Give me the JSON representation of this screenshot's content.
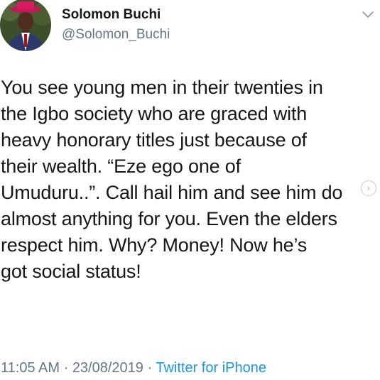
{
  "author": {
    "display_name": "Solomon Buchi",
    "handle": "@Solomon_Buchi"
  },
  "tweet": {
    "lines": [
      "You see young men in their twenties in",
      "the Igbo society who are graced with",
      "heavy honorary titles just because of",
      "their wealth. “Eze ego one of",
      "Umuduru..”. Call hail him and see him do",
      "almost anything for you. Even the elders",
      "respect him. Why? Money! Now he’s",
      "got social status!"
    ],
    "time": "11:05 AM",
    "separator1": " · ",
    "date": "23/08/2019",
    "separator2": " · ",
    "source": "Twitter for iPhone"
  },
  "icons": {
    "menu": "chevron-down-icon",
    "overlay": "chevron-right-circle-icon",
    "overlay_glyph": "›"
  },
  "colors": {
    "text": "#14171a",
    "secondary": "#657786",
    "link": "#1b95e0"
  }
}
